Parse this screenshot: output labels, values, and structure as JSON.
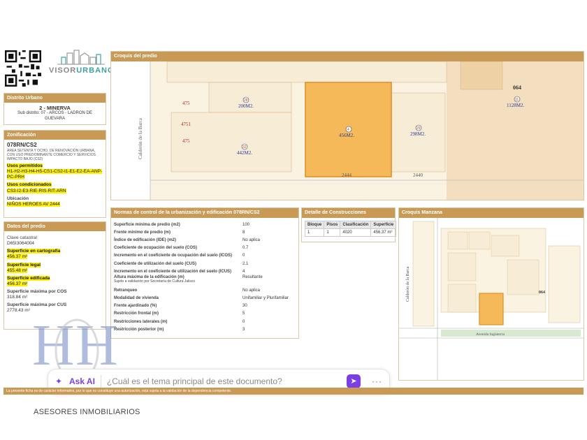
{
  "header": {
    "logo_brand": "VISOR",
    "logo_brand_accent": "URBANO",
    "qr_label": "QR"
  },
  "distrito": {
    "heading": "Distrito Urbano",
    "name": "2 - MINERVA",
    "sub": "Sub distrito: 07 - ARCOS - LADRON DE GUEVARA"
  },
  "zonificacion": {
    "heading": "Zonificación",
    "code": "078RN/CS2",
    "desc": "ÁREA SETENTA Y OCHO, DE RENOVACIÓN URBANA, CON USO PREDOMINANTE COMERCIO Y SERVICIOS IMPACTO BAJO (CS2)",
    "permitidos_label": "Usos permitidos",
    "permitidos": "H1-H2-H3-H4-H5-CS1-CS2-I1-E1-E2-EA-ANP-PC-PRH",
    "condicionados_label": "Usos condicionados",
    "condicionados": "CS3-I2-E3-RIE-RIS-RIT-ARN",
    "ubicacion_label": "Ubicación",
    "ubicacion": "NIÑOS HEROES AV 2444"
  },
  "predio": {
    "heading": "Datos del predio",
    "clave_label": "Clave catastral",
    "clave": "D65I3064004",
    "sup_carto_label": "Superficie en cartografía",
    "sup_carto": "456.37 m²",
    "sup_legal_label": "Superficie legal",
    "sup_legal": "455.48 m²",
    "sup_edif_label": "Superficie edificada",
    "sup_edif": "456.37 m²",
    "sup_cos_label": "Superficie máxima por COS",
    "sup_cos": "318.84 m²",
    "sup_cus_label": "Superficie máxima por CUS",
    "sup_cus": "2778.43 m²"
  },
  "croquis": {
    "heading": "Croquis del predio",
    "street_vertical": "Calderón de la Barca",
    "block_number": "064",
    "lots": [
      {
        "id": "28",
        "area": "200M2."
      },
      {
        "id": "32",
        "area": "442M2."
      },
      {
        "id": "4",
        "area": "456M2."
      },
      {
        "id": "29",
        "area": "298M2."
      },
      {
        "id": "11",
        "area": "1128M2."
      }
    ],
    "side_numbers": [
      "475",
      "4751",
      "475"
    ],
    "street_numbers": [
      "2444",
      "2440"
    ]
  },
  "normas": {
    "heading": "Normas de control de la urbanización y edificación 078RN/CS2",
    "rows": [
      {
        "k": "Superficie mínima de predio (m2)",
        "v": "100"
      },
      {
        "k": "Frente mínimo de predio (m)",
        "v": "8"
      },
      {
        "k": "Índice de edificación (IDE) (m2)",
        "v": "No aplica"
      },
      {
        "k": "Coeficiente de ocupación del suelo (COS)",
        "v": "0.7"
      },
      {
        "k": "Incremento en el coeficiente de ocupación del suelo (ICOS)",
        "v": "0"
      },
      {
        "k": "Coeficiente de utilización del suelo (CUS)",
        "v": "2.1"
      },
      {
        "k": "Incremento en el coeficiente de utilización del suelo (ICUS)",
        "v": "4"
      },
      {
        "k": "Altura máxima de la edificación (m)",
        "v": "Resultante"
      },
      {
        "k": "Retranqueo",
        "v": "No aplica"
      },
      {
        "k": "Modalidad de vivienda",
        "v": "Unifamiliar y Plurifamiliar"
      },
      {
        "k": "Frente ajardinado (%)",
        "v": "30"
      },
      {
        "k": "Restricción frontal (m)",
        "v": "5"
      },
      {
        "k": "Restricciones laterales (m)",
        "v": "0"
      },
      {
        "k": "Restricción posterior (m)",
        "v": "3"
      }
    ],
    "altura_sub": "Sujeto a validación por Secretaría de Cultura Jalisco"
  },
  "construcciones": {
    "heading": "Detalle de Construcciones",
    "columns": [
      "Bloque",
      "Pisos",
      "Clasificación",
      "Superficie"
    ],
    "rows": [
      [
        "1",
        "1",
        "4020",
        "456.37 m²"
      ]
    ]
  },
  "manzana": {
    "heading": "Croquis Manzana",
    "street_vertical": "Calderón de la Barca",
    "street_bottom": "Avenida Inglaterra",
    "block_number": "064"
  },
  "footer": {
    "strip": "La presente ficha es de carácter informativo, por lo que no constituye una autorización, está sujeta a la validación de la dependencia competente.",
    "company": "ASESORES INMOBILIARIOS"
  },
  "askai": {
    "label": "Ask AI",
    "question": "¿Cuál es el tema principal de este documento?",
    "more": "···"
  },
  "colors": {
    "accent": "#c89a56",
    "highlight": "#fff200",
    "lot_selected": "#f5b95a",
    "ai_purple": "#7b3fe4"
  }
}
